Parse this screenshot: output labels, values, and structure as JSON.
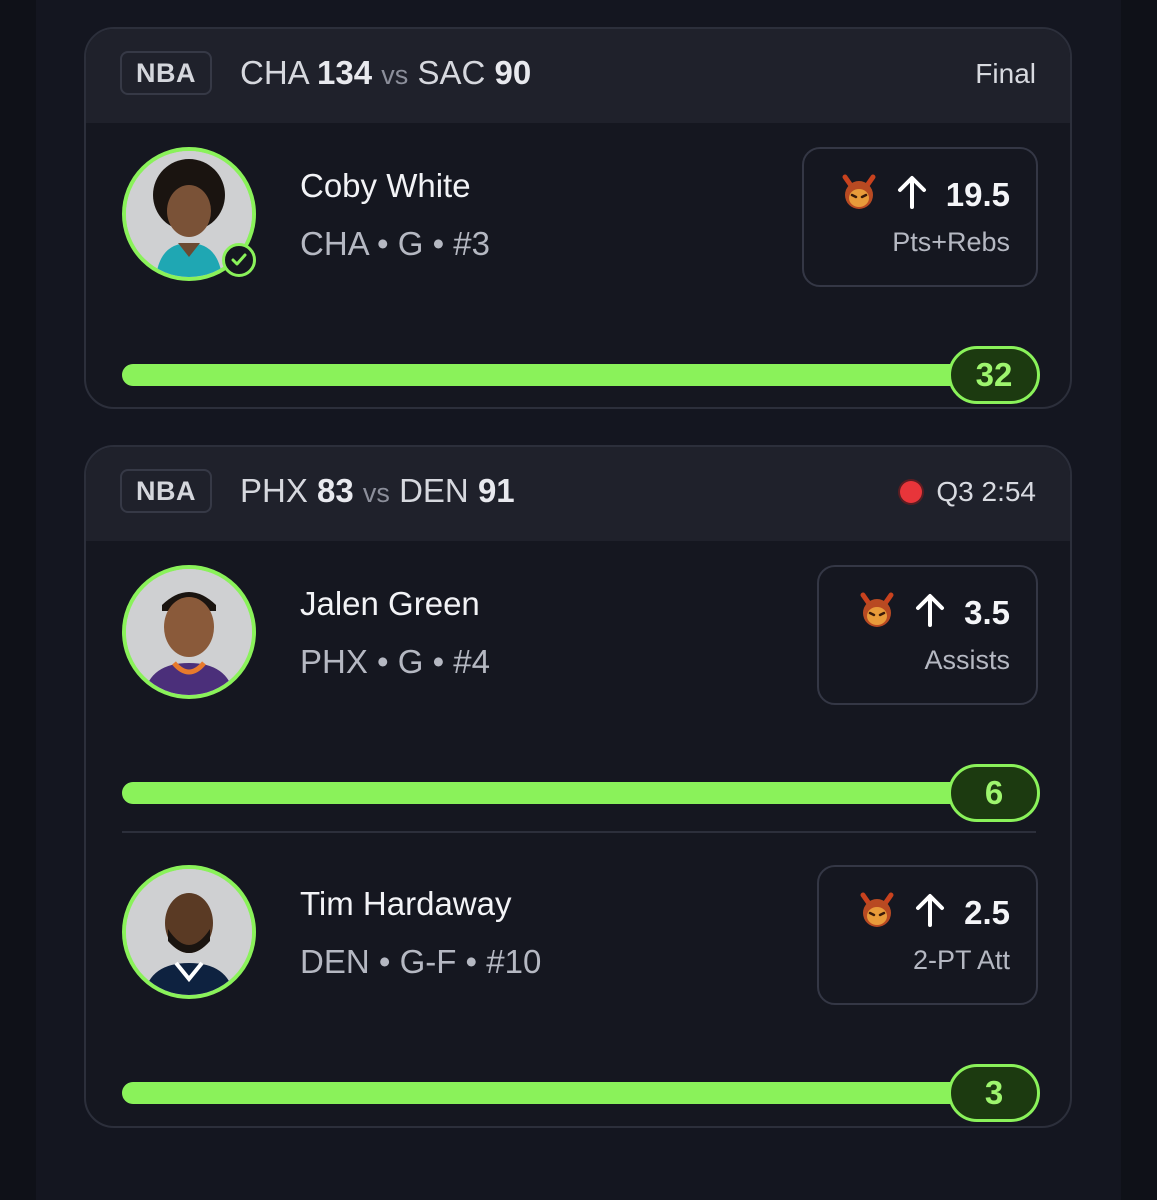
{
  "games": [
    {
      "league": "NBA",
      "team1": "CHA",
      "score1": "134",
      "vs": "vs",
      "team2": "SAC",
      "score2": "90",
      "status": "Final",
      "live": false,
      "players": [
        {
          "name": "Coby White",
          "meta": "CHA • G • #3",
          "line": "19.5",
          "stat": "Pts+Rebs",
          "direction_icon": "arrow-up-icon",
          "result": "32",
          "progress_fraction": 1.0,
          "verified": true
        }
      ]
    },
    {
      "league": "NBA",
      "team1": "PHX",
      "score1": "83",
      "vs": "vs",
      "team2": "DEN",
      "score2": "91",
      "status": "Q3 2:54",
      "live": true,
      "players": [
        {
          "name": "Jalen Green",
          "meta": "PHX • G • #4",
          "line": "3.5",
          "stat": "Assists",
          "direction_icon": "arrow-up-icon",
          "result": "6",
          "progress_fraction": 1.0,
          "verified": false
        },
        {
          "name": "Tim Hardaway",
          "meta": "DEN • G-F • #10",
          "line": "2.5",
          "stat": "2-PT Att",
          "direction_icon": "arrow-up-icon",
          "result": "3",
          "progress_fraction": 1.0,
          "verified": false
        }
      ]
    }
  ],
  "colors": {
    "accent_green": "#8af25a",
    "live_red": "#e8353a",
    "card_bg": "#151720",
    "header_bg": "#1f212b"
  }
}
